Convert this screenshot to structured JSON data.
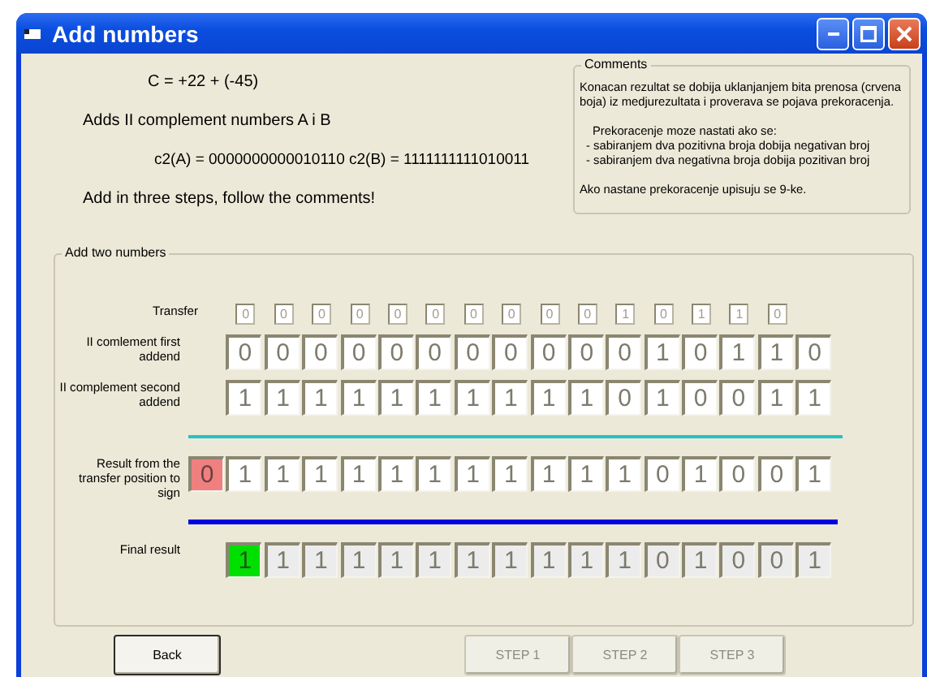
{
  "window": {
    "title": "Add numbers"
  },
  "intro": {
    "equation": "C = +22  +  (-45)",
    "description": "Adds II complement numbers  A i B",
    "operands": "c2(A) = 0000000000010110    c2(B) = 1111111111010011",
    "instruction": "Add in three steps, follow the comments!"
  },
  "comments": {
    "title": "Comments",
    "paragraphs": [
      {
        "kind": "text",
        "text": "Konacan rezultat se dobija uklanjanjem bita prenosa (crvena boja) iz medjurezultata i proverava se pojava prekoracenja."
      },
      {
        "kind": "heading",
        "text": "Prekoracenje moze nastati ako se:"
      },
      {
        "kind": "bullet",
        "text": "- sabiranjem dva pozitivna broja dobija negativan broj"
      },
      {
        "kind": "bullet",
        "text": "- sabiranjem dva negativna broja dobija pozitivan broj"
      },
      {
        "kind": "text",
        "text": "Ako nastane prekoracenje upisuju se 9-ke."
      }
    ]
  },
  "adder": {
    "title": "Add two numbers",
    "rows": [
      {
        "kind": "transfer",
        "label": "Transfer",
        "cells": [
          "",
          "0",
          "0",
          "0",
          "0",
          "0",
          "0",
          "0",
          "0",
          "0",
          "0",
          "1",
          "0",
          "1",
          "1",
          "0"
        ]
      },
      {
        "kind": "addend",
        "label": "II comlement first addend",
        "cells": [
          "",
          "0",
          "0",
          "0",
          "0",
          "0",
          "0",
          "0",
          "0",
          "0",
          "0",
          "0",
          "1",
          "0",
          "1",
          "1",
          "0"
        ]
      },
      {
        "kind": "addend",
        "label": "II complement second addend",
        "cells": [
          "",
          "1",
          "1",
          "1",
          "1",
          "1",
          "1",
          "1",
          "1",
          "1",
          "1",
          "0",
          "1",
          "0",
          "0",
          "1",
          "1"
        ]
      },
      {
        "kind": "result",
        "label": "Result from the transfer position to sign",
        "cells": [
          {
            "value": "0",
            "highlighted": true
          },
          {
            "value": "1",
            "highlighted": false
          },
          {
            "value": "1",
            "highlighted": false
          },
          {
            "value": "1",
            "highlighted": false
          },
          {
            "value": "1",
            "highlighted": false
          },
          {
            "value": "1",
            "highlighted": false
          },
          {
            "value": "1",
            "highlighted": false
          },
          {
            "value": "1",
            "highlighted": false
          },
          {
            "value": "1",
            "highlighted": false
          },
          {
            "value": "1",
            "highlighted": false
          },
          {
            "value": "1",
            "highlighted": false
          },
          {
            "value": "1",
            "highlighted": false
          },
          {
            "value": "0",
            "highlighted": false
          },
          {
            "value": "1",
            "highlighted": false
          },
          {
            "value": "0",
            "highlighted": false
          },
          {
            "value": "0",
            "highlighted": false
          },
          {
            "value": "1",
            "highlighted": false
          }
        ]
      },
      {
        "kind": "final",
        "label": "Final result",
        "cells": [
          "",
          {
            "value": "1",
            "highlighted": true
          },
          {
            "value": "1",
            "highlighted": false
          },
          {
            "value": "1",
            "highlighted": false
          },
          {
            "value": "1",
            "highlighted": false
          },
          {
            "value": "1",
            "highlighted": false
          },
          {
            "value": "1",
            "highlighted": false
          },
          {
            "value": "1",
            "highlighted": false
          },
          {
            "value": "1",
            "highlighted": false
          },
          {
            "value": "1",
            "highlighted": false
          },
          {
            "value": "1",
            "highlighted": false
          },
          {
            "value": "1",
            "highlighted": false
          },
          {
            "value": "0",
            "highlighted": false
          },
          {
            "value": "1",
            "highlighted": false
          },
          {
            "value": "0",
            "highlighted": false
          },
          {
            "value": "0",
            "highlighted": false
          },
          {
            "value": "1",
            "highlighted": false
          }
        ]
      }
    ]
  },
  "buttons": [
    {
      "label": "Back",
      "disabled": false
    },
    {
      "label": "STEP 1",
      "disabled": true
    },
    {
      "label": "STEP 2",
      "disabled": true
    },
    {
      "label": "STEP 3",
      "disabled": true
    }
  ]
}
